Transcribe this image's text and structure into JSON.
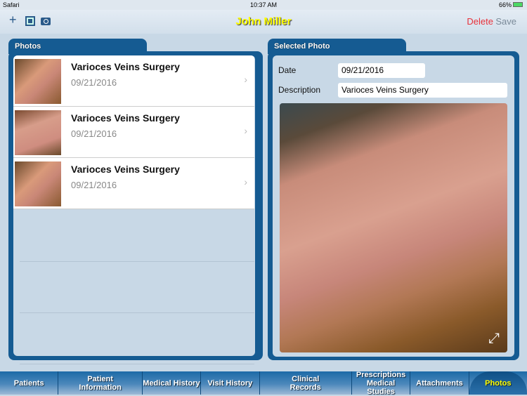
{
  "status": {
    "app": "Safari",
    "time": "10:37 AM",
    "battery": "66%"
  },
  "nav": {
    "title": "John Miller",
    "delete": "Delete",
    "save": "Save",
    "icons": [
      "plus-icon",
      "photo-library-icon",
      "camera-icon"
    ]
  },
  "photos": {
    "header": "Photos",
    "items": [
      {
        "title": "Varioces Veins Surgery",
        "date": "09/21/2016"
      },
      {
        "title": "Varioces Veins Surgery",
        "date": "09/21/2016"
      },
      {
        "title": "Varioces Veins Surgery",
        "date": "09/21/2016"
      }
    ]
  },
  "selected": {
    "header": "Selected Photo",
    "date_label": "Date",
    "date": "09/21/2016",
    "desc_label": "Description",
    "desc": "Varioces Veins Surgery"
  },
  "tabs": [
    {
      "label": "Patients"
    },
    {
      "label": "Patient Information"
    },
    {
      "label": "Medical History"
    },
    {
      "label": "Visit History"
    },
    {
      "label": "Clinical Records"
    },
    {
      "label": "Prescriptions Medical Studies"
    },
    {
      "label": "Attachments"
    },
    {
      "label": "Photos",
      "active": true
    }
  ],
  "colors": {
    "panel": "#155b92",
    "delete": "#e8313a",
    "title": "#ffff00"
  }
}
